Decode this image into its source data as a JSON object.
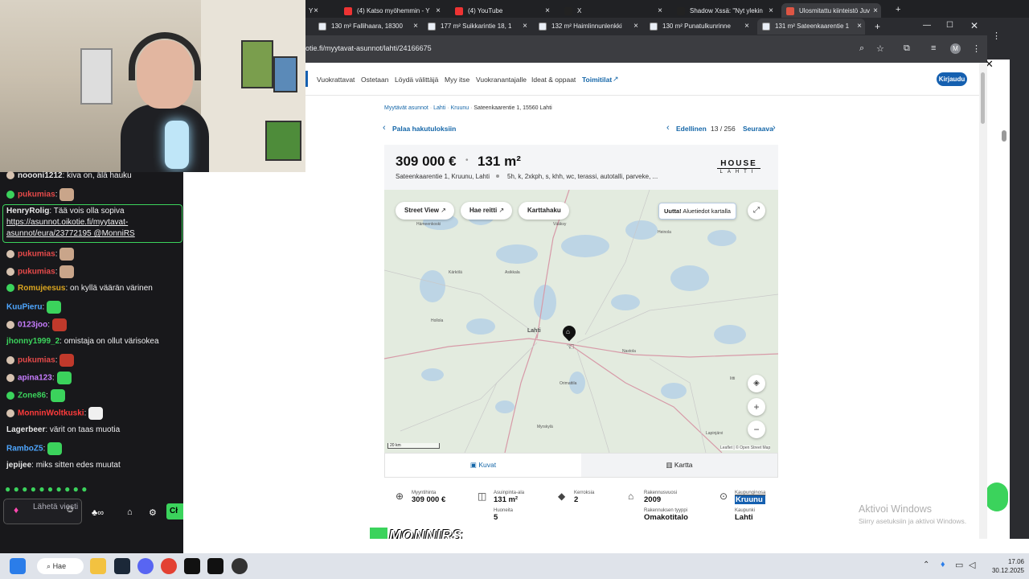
{
  "browser": {
    "tabs_top": [
      {
        "label": "Y",
        "close": "×"
      },
      {
        "label": "(4) Katso myöhemmin - Y",
        "close": "×"
      },
      {
        "label": "(4) YouTube",
        "close": "×"
      },
      {
        "label": "X",
        "close": "×"
      },
      {
        "label": "Shadow Xssä: \"Nyt ylekin",
        "close": "×"
      },
      {
        "label": "Ulosmitattu kiinteistö Juv",
        "close": "×"
      }
    ],
    "tabs_bottom": [
      {
        "label": "130 m² Fallihaara, 18300",
        "close": "×"
      },
      {
        "label": "177 m² Suikkarintie 18, 1",
        "close": "×"
      },
      {
        "label": "132 m² Haimlinnunlenkki",
        "close": "×"
      },
      {
        "label": "130 m² Punatulkunrinne",
        "close": "×"
      },
      {
        "label": "131 m² Sateenkaarentie 1",
        "close": "×"
      }
    ],
    "new_tab": "+",
    "url": "otie.fi/myytavat-asunnot/lahti/24166675",
    "profile_initial": "M"
  },
  "nav": {
    "items": [
      "Vuokrattavat",
      "Ostetaan",
      "Löydä välittäjä",
      "Myy itse",
      "Vuokranantajalle",
      "Ideat & oppaat",
      "Toimitilat"
    ],
    "login": "Kirjaudu"
  },
  "breadcrumb": {
    "a": "Myytävät asunnot",
    "sep1": "·",
    "b": "Lahti",
    "sep2": "·",
    "c": "Kruunu",
    "sep3": "·",
    "d": "Sateenkaarentie 1, 15560 Lahti"
  },
  "pager": {
    "back": "Palaa hakutuloksiin",
    "prev": "Edellinen",
    "position": "13 / 256",
    "next": "Seuraava"
  },
  "listing": {
    "price": "309 000 €",
    "dot": "•",
    "size": "131 m²",
    "address": "Sateenkaarentie 1, Kruunu, Lahti",
    "rooms": "5h, k, 2xkph, s, khh, wc, terassi, autotalli, parveke, ...",
    "brand_top": "HOUSE",
    "brand_bottom": "LAHTI"
  },
  "map": {
    "street_view": "Street View",
    "route": "Hae reitti",
    "map_search": "Karttahaku",
    "new_strong": "Uutta!",
    "new_text": "Aluetiedot kartalla",
    "scale": "20 km",
    "attribution": "Leaflet | © Open Street Map",
    "place_labels": [
      "Lahti",
      "Hollola",
      "Orimattila",
      "Nastola",
      "Heinola",
      "Asikkala",
      "Iitti",
      "Kärkölä",
      "Myrskylä",
      "Lapinjärvi",
      "Hämeenkoski",
      "Vääksy"
    ],
    "zoom_in": "+",
    "zoom_out": "−"
  },
  "toggle": {
    "photos": "Kuvat",
    "map": "Kartta"
  },
  "facts": {
    "price_label": "Myyntihinta",
    "price": "309 000 €",
    "area_label": "Asuinpinta-ala",
    "area": "131 m²",
    "rooms_label": "Huoneita",
    "rooms": "5",
    "floors_label": "Kerroksia",
    "floors": "2",
    "year_label": "Rakennusvuosi",
    "year": "2009",
    "type_label": "Rakennuksen tyyppi",
    "type": "Omakotitalo",
    "district_label": "Kaupunginosa",
    "district": "Kruunu",
    "city_label": "Kaupunki",
    "city": "Lahti"
  },
  "watermark": {
    "line1": "Aktivoi Windows",
    "line2": "Siirry asetuksiin ja aktivoi Windows."
  },
  "overlay_logo": "MONNIRS",
  "chat": {
    "messages": [
      {
        "user": "noooni1212",
        "text": ": kiva on, älä hauku",
        "color": "#e8e8e8"
      },
      {
        "user": "pukumias",
        "text": ":",
        "color": "#e64a4a"
      },
      {
        "user": "HenryRolig",
        "text": ": Tää vois olla sopiva",
        "color": "#e8e8e8"
      },
      {
        "user": "",
        "text": "https://asunnot.oikotie.fi/myytavat-",
        "color": "#efeff1"
      },
      {
        "user": "",
        "text": "asunnot/eura/23772195 @MonniRS",
        "color": "#efeff1"
      },
      {
        "user": "pukumias",
        "text": ":",
        "color": "#e64a4a"
      },
      {
        "user": "pukumias",
        "text": ":",
        "color": "#e64a4a"
      },
      {
        "user": "Romujeesus",
        "text": ": on kyllä väärän värinen",
        "color": "#daa520"
      },
      {
        "user": "KuuPieru",
        "text": ":",
        "color": "#4ea6ff"
      },
      {
        "user": "0123joo",
        "text": ":",
        "color": "#c77dff"
      },
      {
        "user": "jhonny1999_2",
        "text": ": omistaja on ollut värisokea",
        "color": "#3bd35c"
      },
      {
        "user": "pukumias",
        "text": ":",
        "color": "#e64a4a"
      },
      {
        "user": "apina123",
        "text": ":",
        "color": "#c77dff"
      },
      {
        "user": "Zone86",
        "text": ":",
        "color": "#3bd35c"
      },
      {
        "user": "MonninWoltkuski",
        "text": ":",
        "color": "#ff3b3b"
      },
      {
        "user": "Lagerbeer",
        "text": ": värit on taas muotia",
        "color": "#e8e8e8"
      },
      {
        "user": "RamboZ5",
        "text": ":",
        "color": "#4ea6ff"
      },
      {
        "user": "jepijee",
        "text": ": miks sitten edes muutat",
        "color": "#e8e8e8"
      }
    ],
    "send_placeholder": "Lähetä viesti",
    "send_button": "Cł"
  },
  "taskbar": {
    "search": "Hae",
    "time": "17.06",
    "date": "30.12.2025"
  }
}
